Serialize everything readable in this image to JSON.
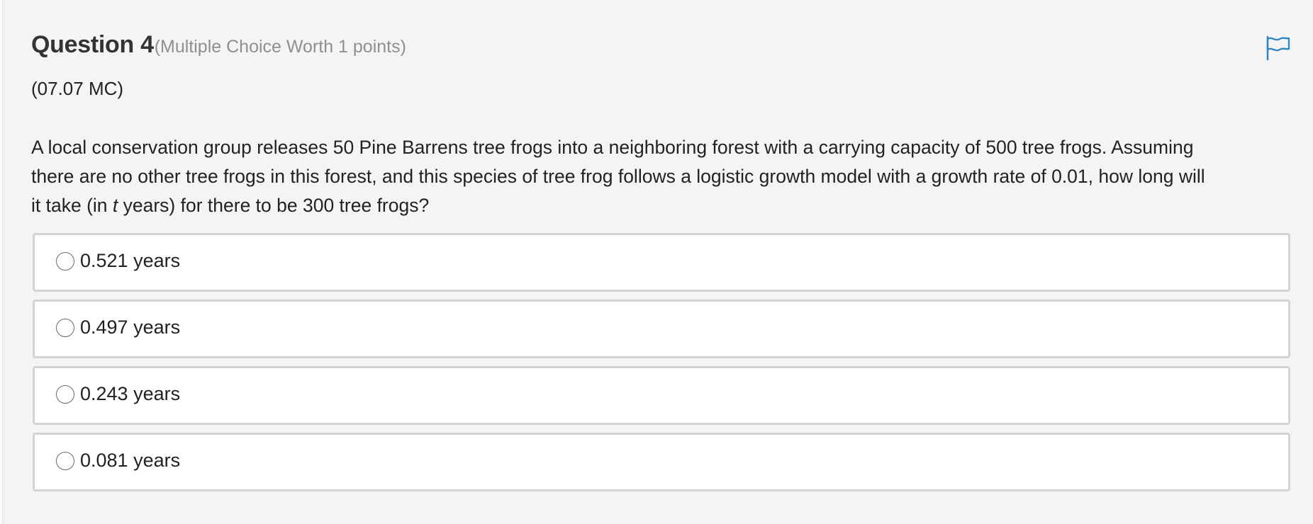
{
  "question": {
    "title": "Question 4",
    "worth": "(Multiple Choice Worth 1 points)",
    "code": "(07.07 MC)",
    "text_lines": [
      "A local conservation group releases 50 Pine Barrens tree frogs into a neighboring forest with a carrying capacity of 500 tree frogs. Assuming",
      "there are no other tree frogs in this forest, and this species of tree frog follows a logistic growth model with a growth rate of 0.01, how long will"
    ],
    "text_line3_before": "it take (in ",
    "text_line3_italic": "t",
    "text_line3_after": " years) for there to be 300 tree frogs?"
  },
  "flag": {
    "icon": "flag-icon",
    "color": "#2f86c4"
  },
  "choices": [
    {
      "label": "0.521 years",
      "selected": false
    },
    {
      "label": "0.497 years",
      "selected": false
    },
    {
      "label": "0.243 years",
      "selected": false
    },
    {
      "label": "0.081 years",
      "selected": false
    }
  ]
}
